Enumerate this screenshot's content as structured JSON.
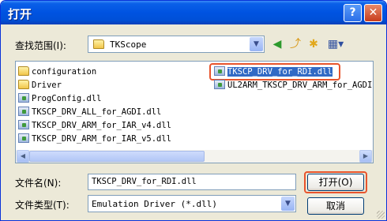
{
  "window": {
    "title": "打开",
    "help": "?",
    "close": "✕"
  },
  "lookin": {
    "label": "查找范围(I):",
    "value": "TKScope"
  },
  "toolbar": {
    "back_icon": "back-arrow-icon",
    "up_icon": "up-folder-icon",
    "newfolder_icon": "new-folder-icon",
    "views_icon": "views-menu-icon"
  },
  "files": {
    "col1": [
      {
        "name": "configuration",
        "type": "folder"
      },
      {
        "name": "Driver",
        "type": "folder"
      },
      {
        "name": "ProgConfig.dll",
        "type": "dll"
      },
      {
        "name": "TKSCP_DRV_ALL_for_AGDI.dll",
        "type": "dll"
      },
      {
        "name": "TKSCP_DRV_ARM_for_IAR_v4.dll",
        "type": "dll"
      },
      {
        "name": "TKSCP_DRV_ARM_for_IAR_v5.dll",
        "type": "dll"
      }
    ],
    "col2": [
      {
        "name": "TKSCP_DRV_for_RDI.dll",
        "type": "dll",
        "selected": true
      },
      {
        "name": "UL2ARM_TKSCP_DRV_ARM_for_AGDI",
        "type": "dll"
      }
    ]
  },
  "filename": {
    "label": "文件名(N):",
    "value": "TKSCP_DRV_for_RDI.dll"
  },
  "filetype": {
    "label": "文件类型(T):",
    "value": "Emulation Driver (*.dll)"
  },
  "buttons": {
    "open": "打开(O)",
    "cancel": "取消"
  },
  "colors": {
    "highlight": "#e8542c",
    "selection": "#316ac5",
    "titlebar": "#0053e1"
  }
}
